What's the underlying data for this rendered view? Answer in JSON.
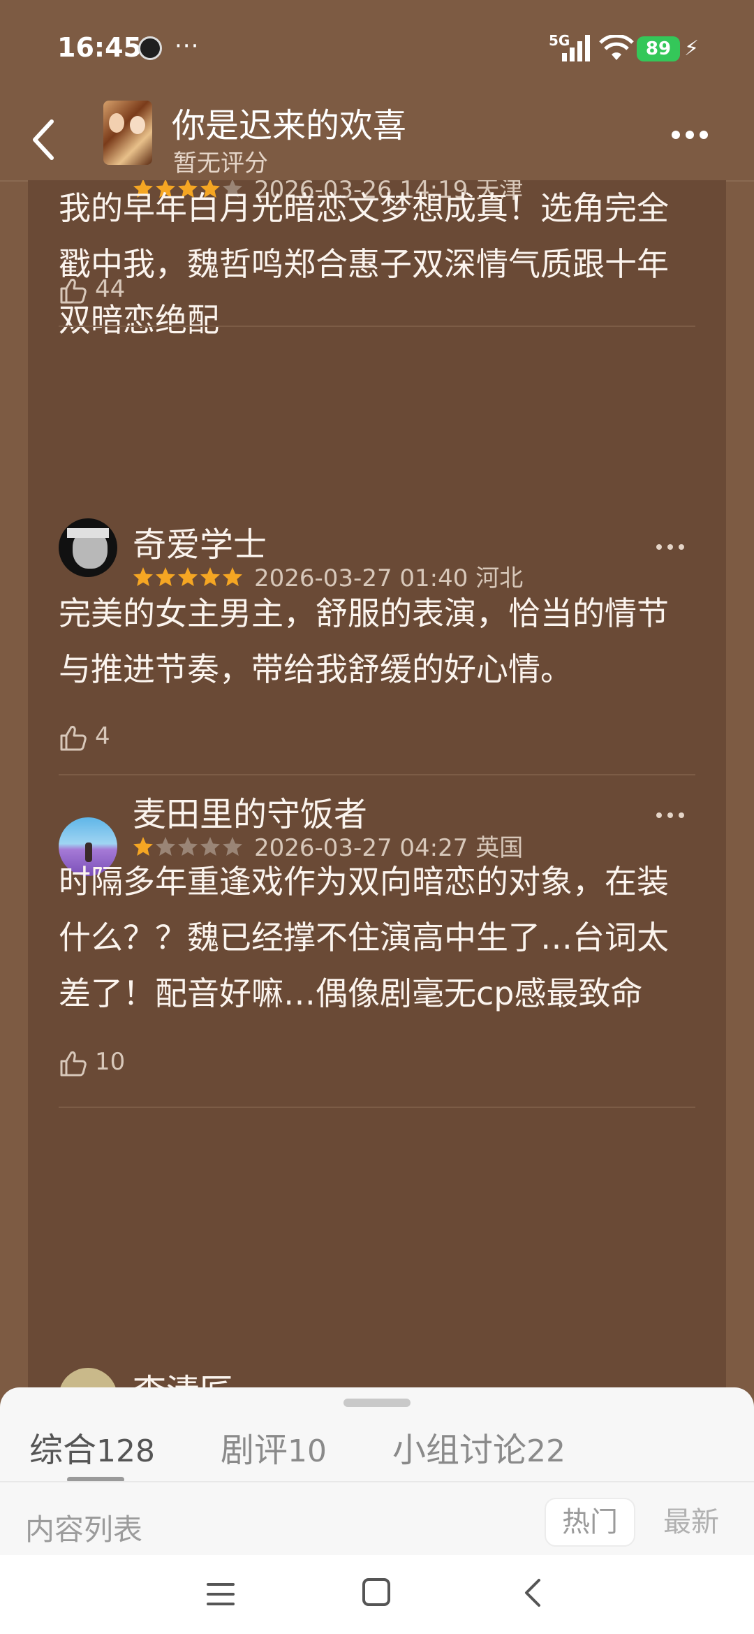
{
  "status_bar": {
    "time": "16:45",
    "dots": "···",
    "network": "5G",
    "battery": "89"
  },
  "header": {
    "title": "你是迟来的欢喜",
    "rating": "暂无评分"
  },
  "reviews": [
    {
      "stars": 4,
      "meta": "2026-03-26 14:19 天津",
      "text": "我的早年白月光暗恋文梦想成真！选角完全戳中我，魏哲鸣郑合惠子双深情气质跟十年双暗恋绝配",
      "likes": "44"
    },
    {
      "name": "奇爱学士",
      "stars": 5,
      "meta": "2026-03-27 01:40 河北",
      "text": "完美的女主男主，舒服的表演，恰当的情节与推进节奏，带给我舒缓的好心情。",
      "likes": "4"
    },
    {
      "name": "麦田里的守饭者",
      "stars": 1,
      "meta": "2026-03-27 04:27 英国",
      "text": "时隔多年重逢戏作为双向暗恋的对象，在装什么？？魏已经撑不住演高中生了…台词太差了！配音好嘛…偶像剧毫无cp感最致命",
      "likes": "10"
    },
    {
      "name": "李清匠"
    }
  ],
  "tabs": [
    {
      "label": "综合",
      "count": "128",
      "active": true
    },
    {
      "label": "剧评",
      "count": "10",
      "active": false
    },
    {
      "label": "小组讨论",
      "count": "22",
      "active": false
    }
  ],
  "list": {
    "label": "内容列表",
    "sort_hot": "热门",
    "sort_new": "最新"
  },
  "colors": {
    "star_filled": "#f5a623",
    "star_empty": "#9a8576",
    "panel_bg": "#6a4a36",
    "page_bg": "#7d5b43"
  }
}
